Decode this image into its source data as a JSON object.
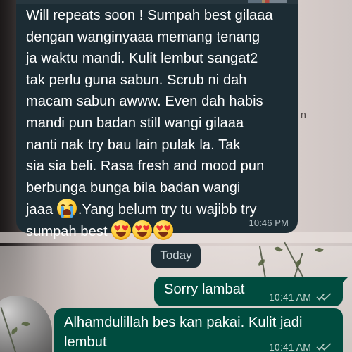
{
  "chat": {
    "incoming": {
      "lines": [
        "Will repeats soon ! Sumpah best gilaaa",
        "dengan wanginyaaa memang tenang",
        "ja waktu mandi. Kulit lembut sangat2",
        "tak perlu guna sabun. Scrub ni dah",
        "macam sabun awww. Even dah habis",
        "mandi pun badan still wangi gilaaa",
        "nanti nak try bau lain pulak la. Tak",
        "sia sia beli. Rasa fresh and mood pun",
        "berbunga bunga bila badan wangi"
      ],
      "line_10_before_emoji": "jaaa ",
      "line_10_after_emoji": ".Yang belum try tu wajibb try",
      "line_11": "sumpah best ",
      "time": "10:46 PM",
      "emoji_1": "crying-face-emoji",
      "emoji_2": "heart-eyes-emoji"
    },
    "date_separator": "Today",
    "outgoing": [
      {
        "text": "Sorry lambat",
        "time": "10:41 AM",
        "status_icon": "double-check-icon"
      },
      {
        "line_1": "Alhamdulillah bes kan pakai. Kulit jadi",
        "line_2": "lembut",
        "time": "10:41 AM",
        "status_icon": "double-check-icon"
      }
    ]
  },
  "background": {
    "partial_glyph": "n"
  },
  "colors": {
    "incoming_bubble": "#1c2c34",
    "outgoing_bubble": "#004c3f",
    "date_chip": "#1f2f37",
    "text": "#ffffff",
    "timestamp": "#b7c2c7"
  }
}
